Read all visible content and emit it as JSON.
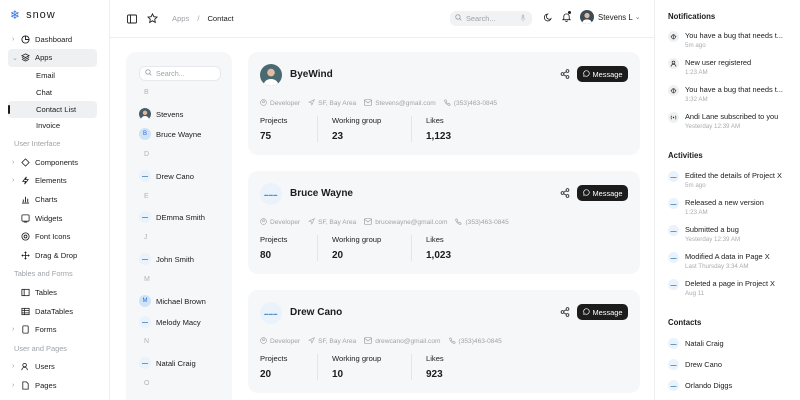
{
  "brand": {
    "name": "snow"
  },
  "sidebar": {
    "dashboard": "Dashboard",
    "apps": "Apps",
    "apps_children": [
      "Email",
      "Chat",
      "Contact List",
      "Invoice"
    ],
    "section_ui": "User Interface",
    "ui_items": [
      "Components",
      "Elements",
      "Charts",
      "Widgets",
      "Font Icons",
      "Drag & Drop"
    ],
    "section_tables": "Tables and Forms",
    "table_items": [
      "Tables",
      "DataTables",
      "Forms"
    ],
    "section_users": "User and Pages",
    "user_items": [
      "Users",
      "Pages"
    ]
  },
  "topbar": {
    "crumb_root": "Apps",
    "crumb_sep": "/",
    "crumb_current": "Contact",
    "search_placeholder": "Search...",
    "user_name": "Stevens L"
  },
  "contact_list": {
    "search_placeholder": "Search...",
    "letters": [
      "B",
      "D",
      "E",
      "J",
      "M",
      "N",
      "O"
    ],
    "contacts": [
      {
        "name": "Stevens",
        "avatar": "photo"
      },
      {
        "name": "Bruce Wayne",
        "avatar": "B"
      },
      {
        "name": "Drew Cano",
        "avatar": "brand"
      },
      {
        "name": "DEmma Smith",
        "avatar": "brand"
      },
      {
        "name": "John Smith",
        "avatar": "brand"
      },
      {
        "name": "Michael Brown",
        "avatar": "M"
      },
      {
        "name": "Melody Macy",
        "avatar": "brand"
      },
      {
        "name": "Natali Craig",
        "avatar": "brand"
      }
    ]
  },
  "cards": [
    {
      "name": "ByeWind",
      "avatar": "photo",
      "message_label": "Message",
      "role": "Developer",
      "location": "SF, Bay Area",
      "email": "Stevens@gmail.com",
      "phone": "(353)463-0845",
      "stats": [
        {
          "label": "Projects",
          "value": "75"
        },
        {
          "label": "Working group",
          "value": "23"
        },
        {
          "label": "Likes",
          "value": "1,123"
        }
      ]
    },
    {
      "name": "Bruce Wayne",
      "avatar": "brand",
      "message_label": "Message",
      "role": "Developer",
      "location": "SF, Bay Area",
      "email": "brucewayne@gmail.com",
      "phone": "(353)463-0845",
      "stats": [
        {
          "label": "Projects",
          "value": "80"
        },
        {
          "label": "Working group",
          "value": "20"
        },
        {
          "label": "Likes",
          "value": "1,023"
        }
      ]
    },
    {
      "name": "Drew Cano",
      "avatar": "brand",
      "message_label": "Message",
      "role": "Developer",
      "location": "SF, Bay Area",
      "email": "drewcano@gmail.com",
      "phone": "(353)463-0845",
      "stats": [
        {
          "label": "Projects",
          "value": "20"
        },
        {
          "label": "Working group",
          "value": "10"
        },
        {
          "label": "Likes",
          "value": "923"
        }
      ]
    }
  ],
  "right_panel": {
    "notifications_title": "Notifications",
    "notifications": [
      {
        "icon": "bug-icon",
        "text": "You have a bug that needs t...",
        "time": "5m ago"
      },
      {
        "icon": "user-icon",
        "text": "New user registered",
        "time": "1:23 AM"
      },
      {
        "icon": "bug-icon",
        "text": "You have a bug that needs t...",
        "time": "3:32 AM"
      },
      {
        "icon": "broadcast-icon",
        "text": "Andi Lane subscribed to you",
        "time": "Yesterday 12:39 AM"
      }
    ],
    "activities_title": "Activities",
    "activities": [
      {
        "text": "Edited the details of Project X",
        "time": "5m ago"
      },
      {
        "text": "Released a new version",
        "time": "1:23 AM"
      },
      {
        "text": "Submitted a bug",
        "time": "Yesterday 12:39 AM"
      },
      {
        "text": "Modified A data in Page X",
        "time": "Last Thursday 3:34 AM"
      },
      {
        "text": "Deleted a page in Project X",
        "time": "Aug 11"
      }
    ],
    "contacts_title": "Contacts",
    "contacts": [
      "Natali Craig",
      "Drew Cano",
      "Orlando Diggs"
    ]
  },
  "colors": {
    "accent": "#2f6fe0",
    "card_bg": "#f6f7f9",
    "dark": "#1c1c1c",
    "muted": "#a0a4a8"
  }
}
